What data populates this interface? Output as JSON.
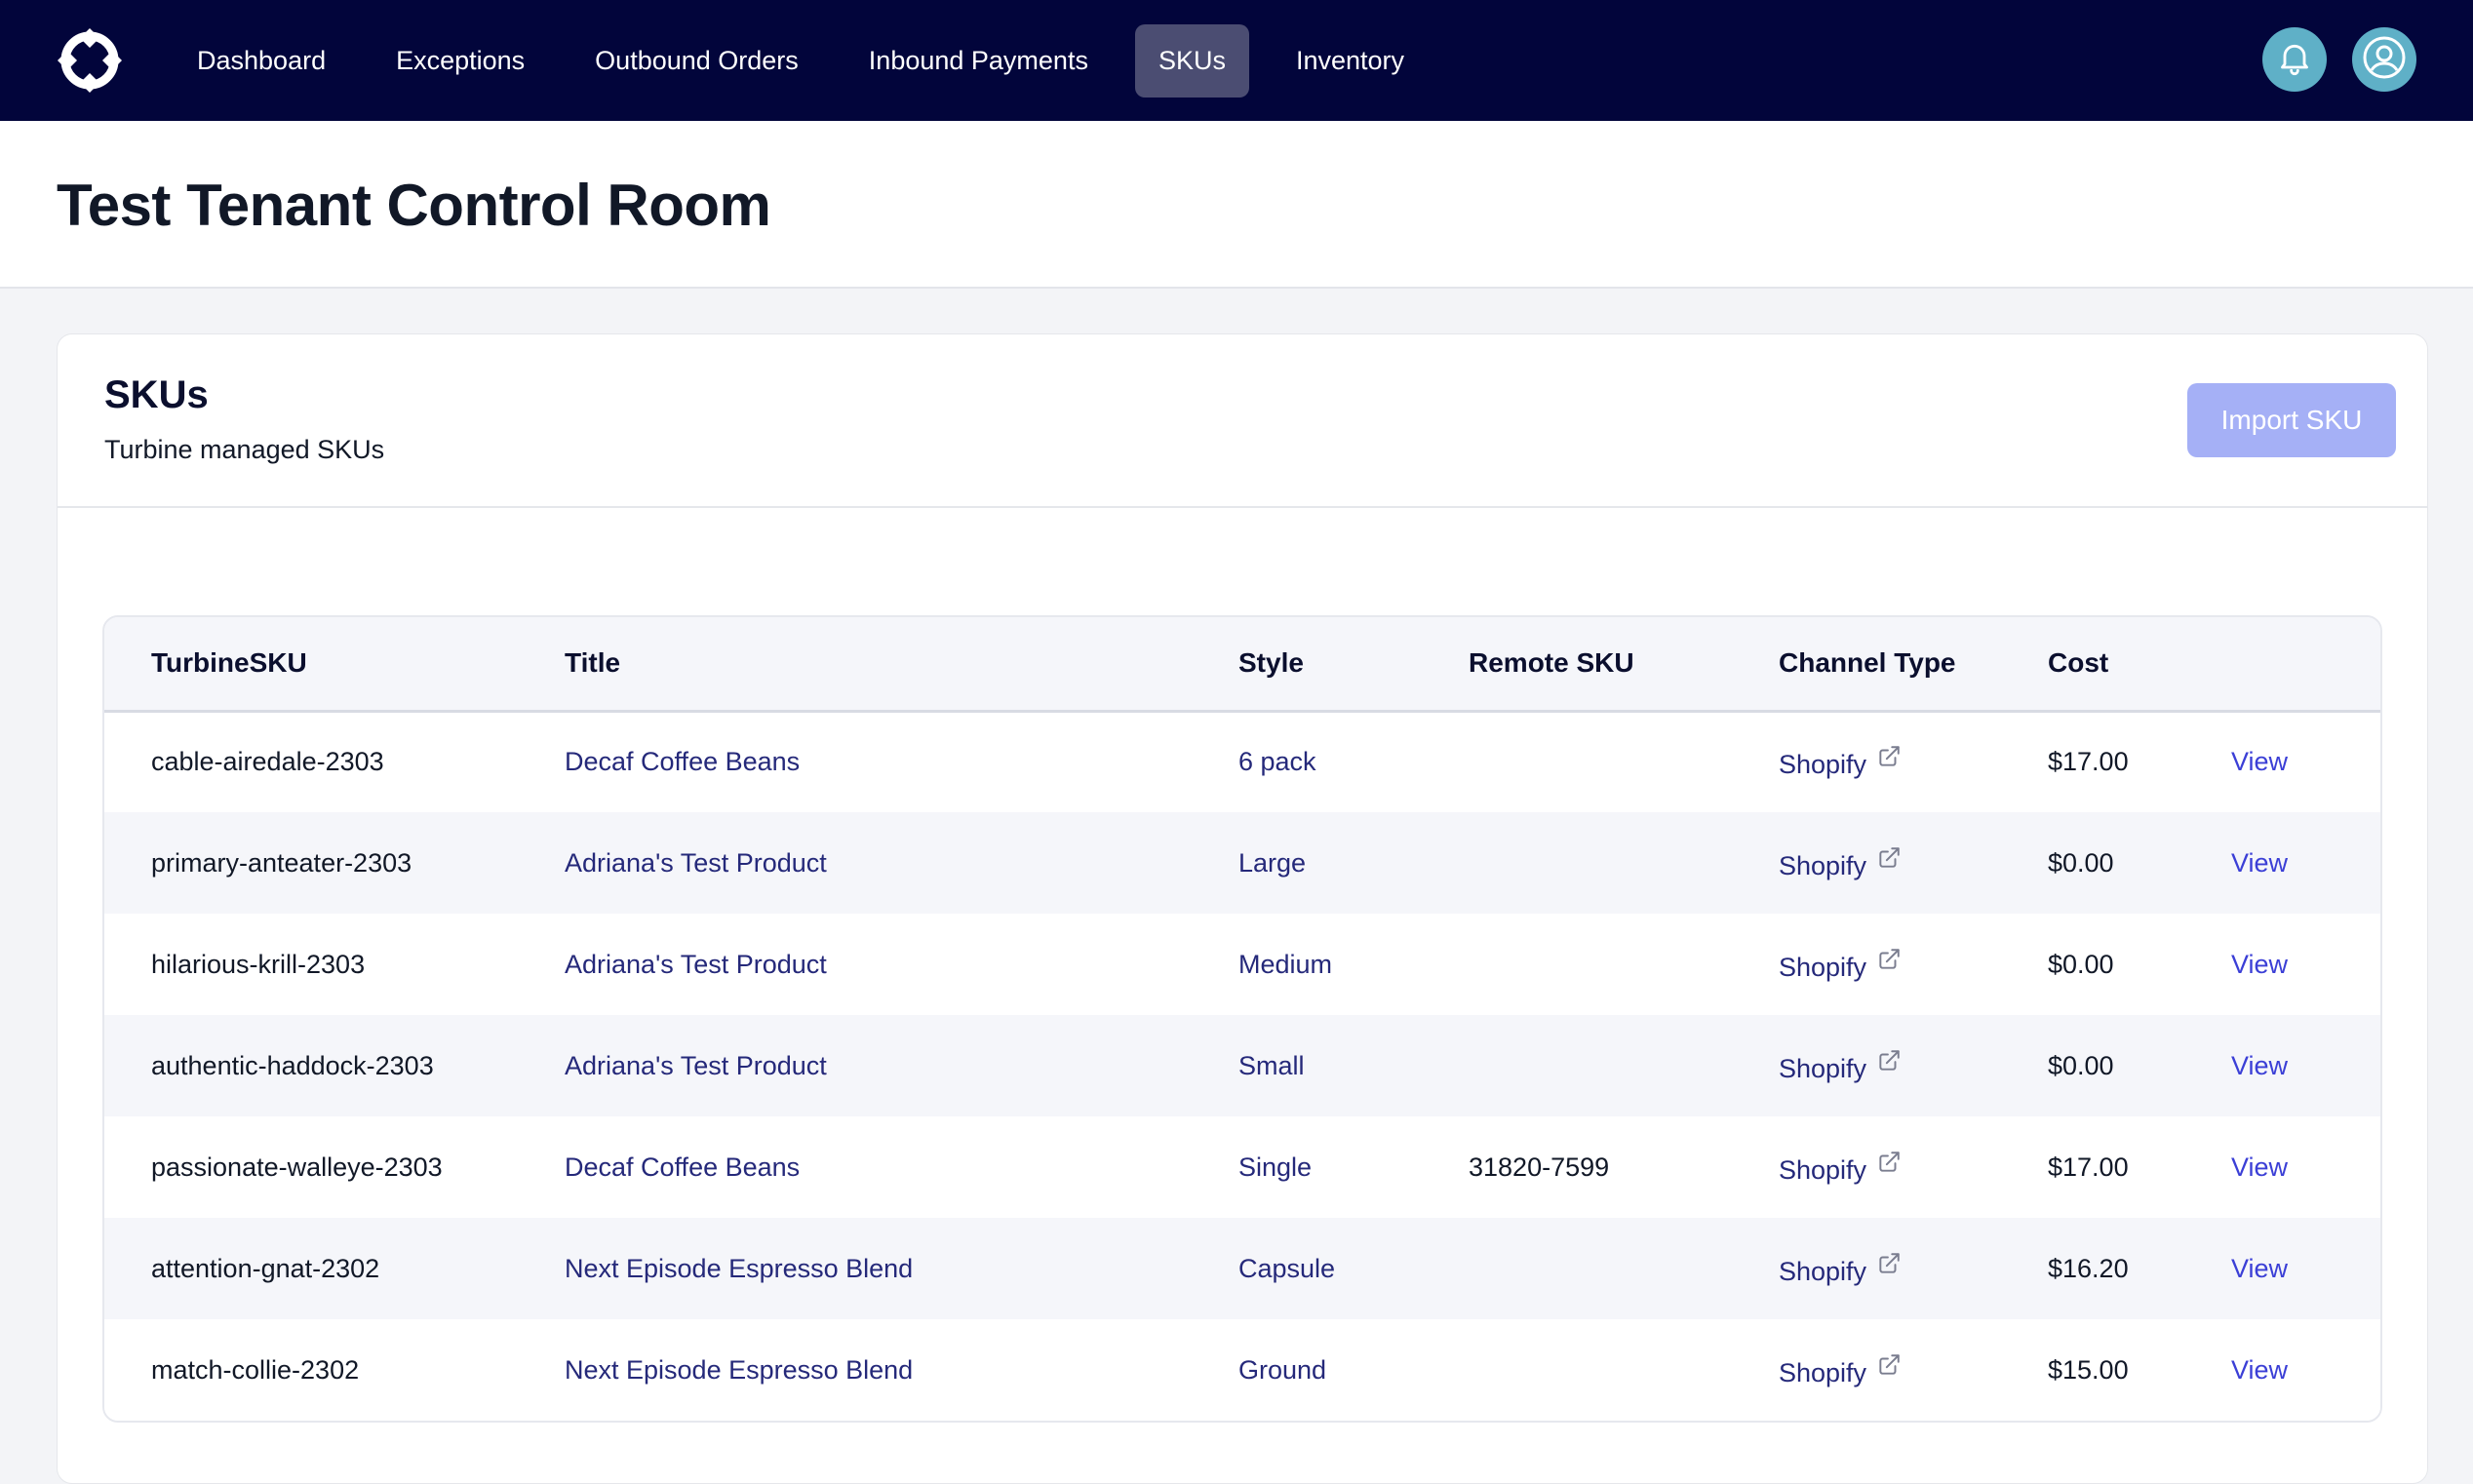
{
  "nav": {
    "items": [
      {
        "label": "Dashboard",
        "active": false
      },
      {
        "label": "Exceptions",
        "active": false
      },
      {
        "label": "Outbound Orders",
        "active": false
      },
      {
        "label": "Inbound Payments",
        "active": false
      },
      {
        "label": "SKUs",
        "active": true
      },
      {
        "label": "Inventory",
        "active": false
      }
    ],
    "icons": [
      "logo-icon",
      "bell-icon",
      "user-icon"
    ],
    "colors": {
      "background": "#02053b",
      "active_tab": "#4b4d72",
      "icon_button": "#5fb0c7"
    }
  },
  "page": {
    "title": "Test Tenant Control Room"
  },
  "card": {
    "title": "SKUs",
    "subtitle": "Turbine managed SKUs",
    "import_button": "Import SKU"
  },
  "table": {
    "headers": [
      "TurbineSKU",
      "Title",
      "Style",
      "Remote SKU",
      "Channel Type",
      "Cost",
      ""
    ],
    "rows": [
      {
        "sku": "cable-airedale-2303",
        "title": "Decaf Coffee Beans",
        "style": "6 pack",
        "remote_sku": "",
        "channel": "Shopify",
        "cost": "$17.00",
        "action": "View"
      },
      {
        "sku": "primary-anteater-2303",
        "title": "Adriana's Test Product",
        "style": "Large",
        "remote_sku": "",
        "channel": "Shopify",
        "cost": "$0.00",
        "action": "View"
      },
      {
        "sku": "hilarious-krill-2303",
        "title": "Adriana's Test Product",
        "style": "Medium",
        "remote_sku": "",
        "channel": "Shopify",
        "cost": "$0.00",
        "action": "View"
      },
      {
        "sku": "authentic-haddock-2303",
        "title": "Adriana's Test Product",
        "style": "Small",
        "remote_sku": "",
        "channel": "Shopify",
        "cost": "$0.00",
        "action": "View"
      },
      {
        "sku": "passionate-walleye-2303",
        "title": "Decaf Coffee Beans",
        "style": "Single",
        "remote_sku": "31820-7599",
        "channel": "Shopify",
        "cost": "$17.00",
        "action": "View"
      },
      {
        "sku": "attention-gnat-2302",
        "title": "Next Episode Espresso Blend",
        "style": "Capsule",
        "remote_sku": "",
        "channel": "Shopify",
        "cost": "$16.20",
        "action": "View"
      },
      {
        "sku": "match-collie-2302",
        "title": "Next Episode Espresso Blend",
        "style": "Ground",
        "remote_sku": "",
        "channel": "Shopify",
        "cost": "$15.00",
        "action": "View"
      }
    ]
  }
}
